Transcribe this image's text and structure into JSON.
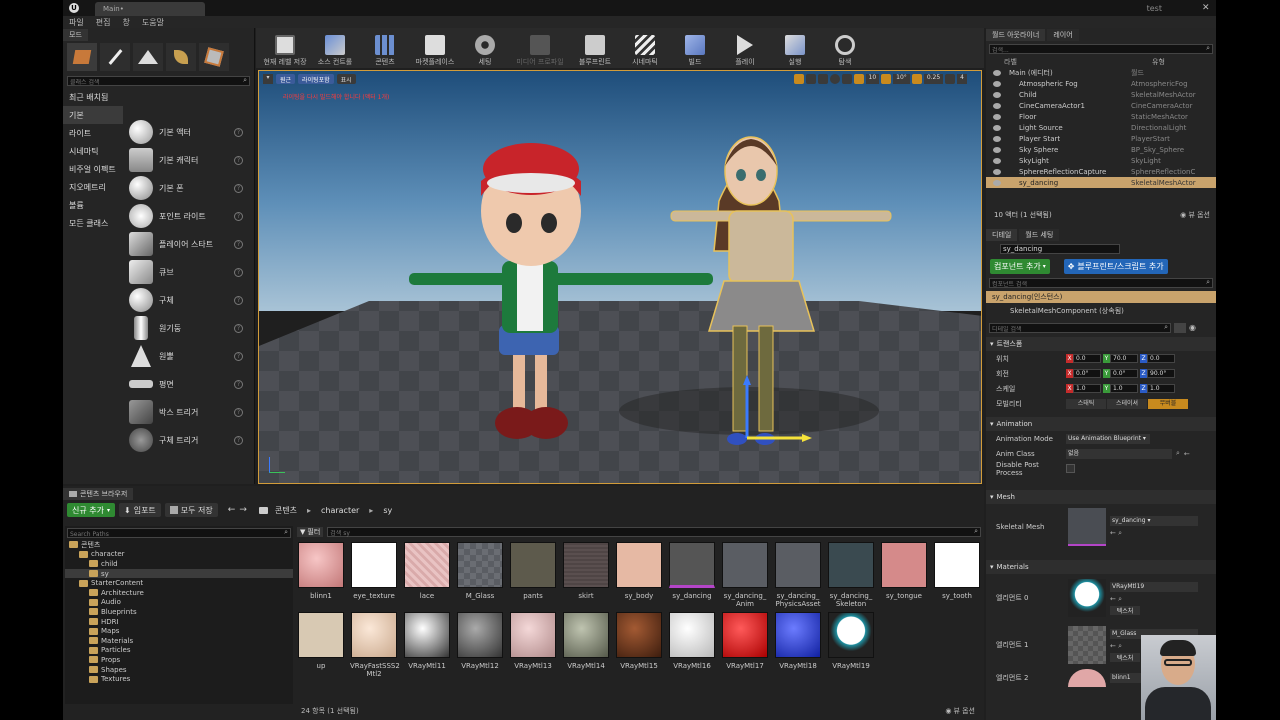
{
  "window": {
    "tab_title": "Main•",
    "project": "test"
  },
  "menu": [
    "파일",
    "편집",
    "창",
    "도움말"
  ],
  "modes": {
    "tab": "모드",
    "search_placeholder": "클래스 검색",
    "categories": [
      "최근 배치됨",
      "기본",
      "라이트",
      "시네마틱",
      "비주얼 이펙트",
      "지오메트리",
      "볼륨",
      "모든 클래스"
    ],
    "selected_category": "기본",
    "items": [
      "기본 액터",
      "기본 캐릭터",
      "기본 폰",
      "포인트 라이트",
      "플레이어 스타트",
      "큐브",
      "구체",
      "원기둥",
      "원뿔",
      "평면",
      "박스 트리거",
      "구체 트리거"
    ]
  },
  "toolbar": {
    "buttons": [
      "현재 레벨 저장",
      "소스 컨트롤",
      "콘텐츠",
      "마켓플레이스",
      "세팅",
      "",
      "블루프린트",
      "시네마틱",
      "빌드",
      "플레이",
      "실행",
      "탐색"
    ],
    "disabled_label": "미디어 프로파일"
  },
  "viewport": {
    "view_mode": "원근",
    "lighting": "라이팅포함",
    "show": "표시",
    "warning": "라이팅을 다시 빌드해야 합니다 (액터 1개)",
    "snap_angle": "10°",
    "snap_grid": "10",
    "scale_snap": "0.25",
    "camera_speed": "4"
  },
  "content_browser": {
    "tab": "콘텐츠 브라우저",
    "add_new": "신규 추가",
    "import": "임포트",
    "save_all": "모두 저장",
    "breadcrumb": [
      "콘텐츠",
      "character",
      "sy"
    ],
    "search_paths_placeholder": "Search Paths",
    "filter": "필터",
    "search_placeholder": "검색 sy",
    "tree": [
      {
        "label": "콘텐츠",
        "level": 0
      },
      {
        "label": "character",
        "level": 1
      },
      {
        "label": "child",
        "level": 2
      },
      {
        "label": "sy",
        "level": 2,
        "selected": true
      },
      {
        "label": "StarterContent",
        "level": 1
      },
      {
        "label": "Architecture",
        "level": 2
      },
      {
        "label": "Audio",
        "level": 2
      },
      {
        "label": "Blueprints",
        "level": 2
      },
      {
        "label": "HDRI",
        "level": 2
      },
      {
        "label": "Maps",
        "level": 2
      },
      {
        "label": "Materials",
        "level": 2
      },
      {
        "label": "Particles",
        "level": 2
      },
      {
        "label": "Props",
        "level": 2
      },
      {
        "label": "Shapes",
        "level": 2
      },
      {
        "label": "Textures",
        "level": 2
      }
    ],
    "assets_row1": [
      "blinn1",
      "eye_texture",
      "lace",
      "M_Glass",
      "pants",
      "skirt",
      "sy_body",
      "sy_dancing",
      "sy_dancing_ Anim",
      "sy_dancing_ PhysicsAsset",
      "sy_dancing_ Skeleton",
      "sy_tongue",
      "sy_tooth"
    ],
    "assets_row2": [
      "up",
      "VRayFastSSS2 Mtl2",
      "VRayMtl11",
      "VRayMtl12",
      "VRayMtl13",
      "VRayMtl14",
      "VRayMtl15",
      "VRayMtl16",
      "VRayMtl17",
      "VRayMtl18",
      "VRayMtl19"
    ],
    "status": "24 항목 (1 선택됨)",
    "view_options": "뷰 옵션"
  },
  "outliner": {
    "tabs": [
      "월드 아웃라이너",
      "레이어"
    ],
    "search_placeholder": "검색...",
    "col_label": "라벨",
    "col_type": "유형",
    "rows": [
      {
        "name": "Main (에디터)",
        "type": "월드"
      },
      {
        "name": "Atmospheric Fog",
        "type": "AtmosphericFog"
      },
      {
        "name": "Child",
        "type": "SkeletalMeshActor"
      },
      {
        "name": "CineCameraActor1",
        "type": "CineCameraActor"
      },
      {
        "name": "Floor",
        "type": "StaticMeshActor"
      },
      {
        "name": "Light Source",
        "type": "DirectionalLight"
      },
      {
        "name": "Player Start",
        "type": "PlayerStart"
      },
      {
        "name": "Sky Sphere",
        "type": "BP_Sky_Sphere"
      },
      {
        "name": "SkyLight",
        "type": "SkyLight"
      },
      {
        "name": "SphereReflectionCapture",
        "type": "SphereReflectionC"
      },
      {
        "name": "sy_dancing",
        "type": "SkeletalMeshActor"
      }
    ],
    "selected_row": "sy_dancing",
    "footer": "10 액터 (1 선택됨)",
    "view_options": "뷰 옵션"
  },
  "details": {
    "tabs": [
      "디테일",
      "월드 세팅"
    ],
    "actor_name": "sy_dancing",
    "add_component": "컴포넌트 추가",
    "blueprint_btn": "블루프린트/스크립트 추가",
    "comp_search_placeholder": "컴포넌트 검색",
    "instance": "sy_dancing(인스턴스)",
    "component": "SkeletalMeshComponent (상속됨)",
    "detail_search_placeholder": "디테일 검색",
    "transform_section": "트랜스폼",
    "location": {
      "label": "위치",
      "x": "0.0",
      "y": "70.0",
      "z": "0.0"
    },
    "rotation": {
      "label": "회전",
      "x": "0.0°",
      "y": "0.0°",
      "z": "90.0°"
    },
    "scale": {
      "label": "스케일",
      "x": "1.0",
      "y": "1.0",
      "z": "1.0"
    },
    "mobility": {
      "label": "모빌리티",
      "options": [
        "스태틱",
        "스테이셔",
        "무버블"
      ]
    },
    "animation_section": "Animation",
    "anim_mode_label": "Animation Mode",
    "anim_mode_value": "Use Animation Blueprint",
    "anim_class_label": "Anim Class",
    "anim_class_value": "없음",
    "disable_pp_label": "Disable Post Process",
    "mesh_section": "Mesh",
    "skeletal_mesh_label": "Skeletal Mesh",
    "skeletal_mesh_value": "sy_dancing",
    "materials_section": "Materials",
    "elements": [
      {
        "label": "엘리먼트 0",
        "value": "VRayMtl19"
      },
      {
        "label": "엘리먼트 1",
        "value": "M_Glass"
      },
      {
        "label": "엘리먼트 2",
        "value": "blinn1"
      }
    ],
    "texture_btn": "텍스처"
  }
}
